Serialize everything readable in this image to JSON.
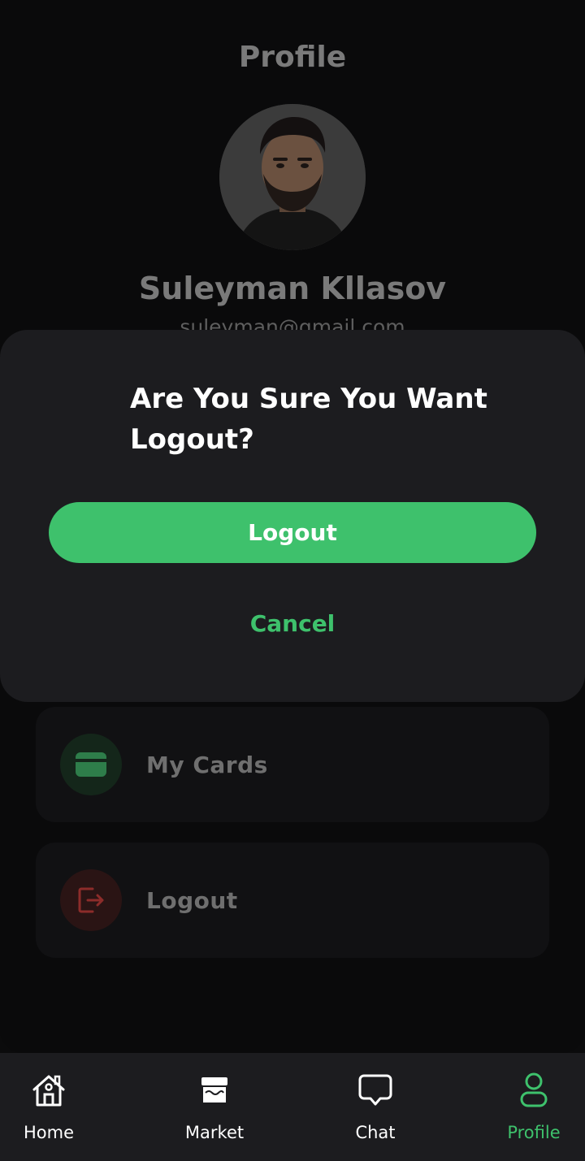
{
  "header": {
    "title": "Profile"
  },
  "profile": {
    "name": "Suleyman Kllasov",
    "email": "suleyman@gmail.com"
  },
  "menu": [
    {
      "label": "My Cards",
      "icon": "card-icon",
      "accent": "#3ec16c"
    },
    {
      "label": "Logout",
      "icon": "logout-icon",
      "accent": "#b8322f"
    }
  ],
  "modal": {
    "question": "Are You Sure You Want Logout?",
    "confirm_label": "Logout",
    "cancel_label": "Cancel"
  },
  "nav": {
    "items": [
      {
        "label": "Home",
        "icon": "home-icon"
      },
      {
        "label": "Market",
        "icon": "store-icon"
      },
      {
        "label": "Chat",
        "icon": "chat-icon"
      },
      {
        "label": "Profile",
        "icon": "user-icon",
        "active": true
      }
    ]
  },
  "colors": {
    "accent": "#3ec16c",
    "danger": "#b8322f",
    "sheet": "#1c1c1f"
  }
}
